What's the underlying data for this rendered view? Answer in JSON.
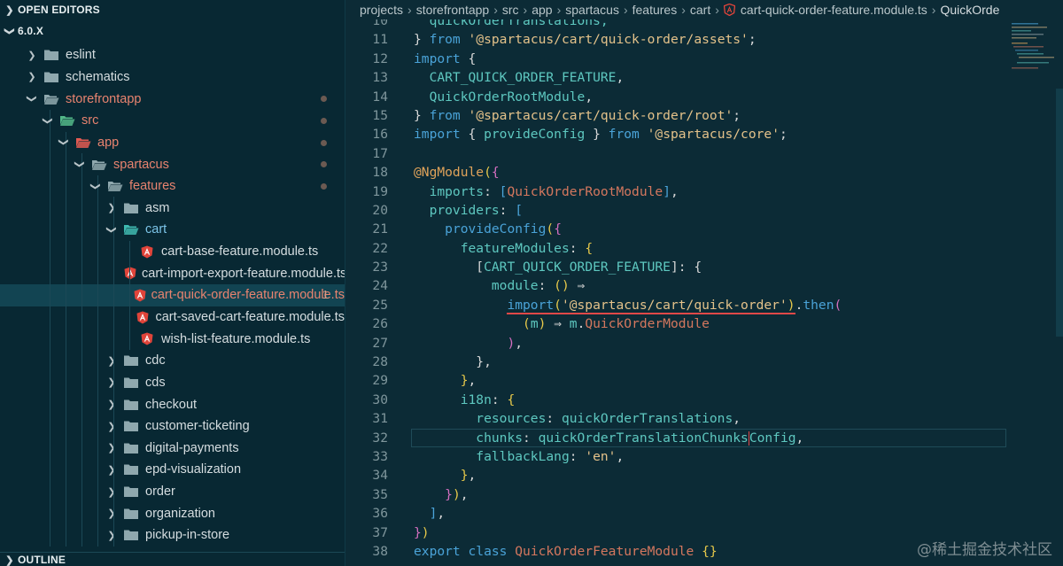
{
  "sidebar": {
    "open_editors_label": "OPEN EDITORS",
    "project_label": "6.0.X",
    "outline_label": "OUTLINE",
    "tree": [
      {
        "label": "eslint",
        "depth": 1,
        "type": "folder",
        "expanded": false,
        "git": false
      },
      {
        "label": "schematics",
        "depth": 1,
        "type": "folder",
        "expanded": false,
        "git": false
      },
      {
        "label": "storefrontapp",
        "depth": 1,
        "type": "folder-open",
        "expanded": true,
        "git": true,
        "dot": true
      },
      {
        "label": "src",
        "depth": 2,
        "type": "src-folder",
        "expanded": true,
        "git": true,
        "dot": true
      },
      {
        "label": "app",
        "depth": 3,
        "type": "app-folder",
        "expanded": true,
        "git": true,
        "dot": true
      },
      {
        "label": "spartacus",
        "depth": 4,
        "type": "folder-open",
        "expanded": true,
        "git": true,
        "dot": true
      },
      {
        "label": "features",
        "depth": 5,
        "type": "folder-open",
        "expanded": true,
        "git": true,
        "dot": true
      },
      {
        "label": "asm",
        "depth": 6,
        "type": "folder",
        "expanded": false,
        "git": false
      },
      {
        "label": "cart",
        "depth": 6,
        "type": "cart-folder",
        "expanded": true,
        "git": false,
        "blue": true
      },
      {
        "label": "cart-base-feature.module.ts",
        "depth": 7,
        "type": "angular",
        "git": false
      },
      {
        "label": "cart-import-export-feature.module.ts",
        "depth": 7,
        "type": "angular",
        "git": false
      },
      {
        "label": "cart-quick-order-feature.module.ts",
        "depth": 7,
        "type": "angular",
        "git": true,
        "active": true,
        "badge": "1"
      },
      {
        "label": "cart-saved-cart-feature.module.ts",
        "depth": 7,
        "type": "angular",
        "git": false
      },
      {
        "label": "wish-list-feature.module.ts",
        "depth": 7,
        "type": "angular",
        "git": false
      },
      {
        "label": "cdc",
        "depth": 6,
        "type": "folder",
        "expanded": false,
        "git": false
      },
      {
        "label": "cds",
        "depth": 6,
        "type": "folder",
        "expanded": false,
        "git": false
      },
      {
        "label": "checkout",
        "depth": 6,
        "type": "folder",
        "expanded": false,
        "git": false
      },
      {
        "label": "customer-ticketing",
        "depth": 6,
        "type": "folder",
        "expanded": false,
        "git": false
      },
      {
        "label": "digital-payments",
        "depth": 6,
        "type": "folder",
        "expanded": false,
        "git": false
      },
      {
        "label": "epd-visualization",
        "depth": 6,
        "type": "folder",
        "expanded": false,
        "git": false
      },
      {
        "label": "order",
        "depth": 6,
        "type": "folder",
        "expanded": false,
        "git": false
      },
      {
        "label": "organization",
        "depth": 6,
        "type": "folder",
        "expanded": false,
        "git": false
      },
      {
        "label": "pickup-in-store",
        "depth": 6,
        "type": "folder",
        "expanded": false,
        "git": false
      }
    ]
  },
  "breadcrumb": [
    "projects",
    "storefrontapp",
    "src",
    "app",
    "spartacus",
    "features",
    "cart",
    "cart-quick-order-feature.module.ts",
    "QuickOrde"
  ],
  "code": [
    {
      "n": "10",
      "t": [
        [
          "prop",
          "  quickOrderTranslations,"
        ]
      ]
    },
    {
      "n": "11",
      "t": [
        [
          "pu",
          "} "
        ],
        [
          "kw",
          "from"
        ],
        [
          "pu",
          " "
        ],
        [
          "str",
          "'@spartacus/cart/quick-order/assets'"
        ],
        [
          "pu",
          ";"
        ]
      ]
    },
    {
      "n": "12",
      "t": [
        [
          "kw",
          "import"
        ],
        [
          "pu",
          " {"
        ]
      ]
    },
    {
      "n": "13",
      "t": [
        [
          "pu",
          "  "
        ],
        [
          "prop",
          "CART_QUICK_ORDER_FEATURE"
        ],
        [
          "pu",
          ","
        ]
      ]
    },
    {
      "n": "14",
      "t": [
        [
          "pu",
          "  "
        ],
        [
          "prop",
          "QuickOrderRootModule"
        ],
        [
          "pu",
          ","
        ]
      ]
    },
    {
      "n": "15",
      "t": [
        [
          "pu",
          "} "
        ],
        [
          "kw",
          "from"
        ],
        [
          "pu",
          " "
        ],
        [
          "str",
          "'@spartacus/cart/quick-order/root'"
        ],
        [
          "pu",
          ";"
        ]
      ]
    },
    {
      "n": "16",
      "t": [
        [
          "kw",
          "import"
        ],
        [
          "pu",
          " { "
        ],
        [
          "prop",
          "provideConfig"
        ],
        [
          "pu",
          " } "
        ],
        [
          "kw",
          "from"
        ],
        [
          "pu",
          " "
        ],
        [
          "str",
          "'@spartacus/core'"
        ],
        [
          "pu",
          ";"
        ]
      ]
    },
    {
      "n": "17",
      "t": []
    },
    {
      "n": "18",
      "t": [
        [
          "dec",
          "@NgModule"
        ],
        [
          "br",
          "("
        ],
        [
          "br2",
          "{"
        ]
      ]
    },
    {
      "n": "19",
      "t": [
        [
          "pu",
          "  "
        ],
        [
          "prop",
          "imports"
        ],
        [
          "pu",
          ": "
        ],
        [
          "fn",
          "["
        ],
        [
          "id",
          "QuickOrderRootModule"
        ],
        [
          "fn",
          "]"
        ],
        [
          "pu",
          ","
        ]
      ]
    },
    {
      "n": "20",
      "t": [
        [
          "pu",
          "  "
        ],
        [
          "prop",
          "providers"
        ],
        [
          "pu",
          ": "
        ],
        [
          "fn",
          "["
        ]
      ]
    },
    {
      "n": "21",
      "t": [
        [
          "pu",
          "    "
        ],
        [
          "fn",
          "provideConfig"
        ],
        [
          "br",
          "("
        ],
        [
          "br2",
          "{"
        ]
      ]
    },
    {
      "n": "22",
      "t": [
        [
          "pu",
          "      "
        ],
        [
          "prop",
          "featureModules"
        ],
        [
          "pu",
          ": "
        ],
        [
          "br",
          "{"
        ]
      ]
    },
    {
      "n": "23",
      "t": [
        [
          "pu",
          "        "
        ],
        [
          "pu",
          "["
        ],
        [
          "prop",
          "CART_QUICK_ORDER_FEATURE"
        ],
        [
          "pu",
          "]: "
        ],
        [
          "pu",
          "{"
        ]
      ]
    },
    {
      "n": "24",
      "t": [
        [
          "pu",
          "          "
        ],
        [
          "prop",
          "module"
        ],
        [
          "pu",
          ": "
        ],
        [
          "br",
          "()"
        ],
        [
          "pu",
          " ⇒"
        ]
      ]
    },
    {
      "n": "25",
      "t": [
        [
          "pu",
          "            "
        ],
        [
          "kw",
          "import",
          "u"
        ],
        [
          "br",
          "(",
          "u"
        ],
        [
          "str",
          "'@spartacus/cart/quick-order'",
          "u"
        ],
        [
          "br",
          ")",
          "u"
        ],
        [
          "pu",
          "."
        ],
        [
          "fn",
          "then"
        ],
        [
          "br2",
          "("
        ]
      ]
    },
    {
      "n": "26",
      "t": [
        [
          "pu",
          "              "
        ],
        [
          "br",
          "("
        ],
        [
          "prop",
          "m"
        ],
        [
          "br",
          ")"
        ],
        [
          "pu",
          " ⇒ "
        ],
        [
          "prop",
          "m"
        ],
        [
          "pu",
          "."
        ],
        [
          "id",
          "QuickOrderModule"
        ]
      ]
    },
    {
      "n": "27",
      "t": [
        [
          "pu",
          "            "
        ],
        [
          "br2",
          ")"
        ],
        [
          "pu",
          ","
        ]
      ]
    },
    {
      "n": "28",
      "t": [
        [
          "pu",
          "        "
        ],
        [
          "pu",
          "},"
        ]
      ]
    },
    {
      "n": "29",
      "t": [
        [
          "pu",
          "      "
        ],
        [
          "br",
          "}"
        ],
        [
          "pu",
          ","
        ]
      ]
    },
    {
      "n": "30",
      "t": [
        [
          "pu",
          "      "
        ],
        [
          "prop",
          "i18n"
        ],
        [
          "pu",
          ": "
        ],
        [
          "br",
          "{"
        ]
      ]
    },
    {
      "n": "31",
      "t": [
        [
          "pu",
          "        "
        ],
        [
          "prop",
          "resources"
        ],
        [
          "pu",
          ": "
        ],
        [
          "prop",
          "quickOrderTranslations"
        ],
        [
          "pu",
          ","
        ]
      ]
    },
    {
      "n": "32",
      "t": [
        [
          "pu",
          "        "
        ],
        [
          "prop",
          "chunks"
        ],
        [
          "pu",
          ": "
        ],
        [
          "prop",
          "quickOrderTranslationChunks"
        ],
        [
          "cursor",
          ""
        ],
        [
          "prop",
          "Config"
        ],
        [
          "pu",
          ","
        ]
      ],
      "cur": true
    },
    {
      "n": "33",
      "t": [
        [
          "pu",
          "        "
        ],
        [
          "prop",
          "fallbackLang"
        ],
        [
          "pu",
          ": "
        ],
        [
          "str",
          "'en'"
        ],
        [
          "pu",
          ","
        ]
      ]
    },
    {
      "n": "34",
      "t": [
        [
          "pu",
          "      "
        ],
        [
          "br",
          "}"
        ],
        [
          "pu",
          ","
        ]
      ]
    },
    {
      "n": "35",
      "t": [
        [
          "pu",
          "    "
        ],
        [
          "br2",
          "}"
        ],
        [
          "br",
          ")"
        ],
        [
          "pu",
          ","
        ]
      ]
    },
    {
      "n": "36",
      "t": [
        [
          "pu",
          "  "
        ],
        [
          "fn",
          "]"
        ],
        [
          "pu",
          ","
        ]
      ]
    },
    {
      "n": "37",
      "t": [
        [
          "br2",
          "}"
        ],
        [
          "br",
          ")"
        ]
      ]
    },
    {
      "n": "38",
      "t": [
        [
          "kw",
          "export"
        ],
        [
          "pu",
          " "
        ],
        [
          "kw",
          "class"
        ],
        [
          "pu",
          " "
        ],
        [
          "cls",
          "QuickOrderFeatureModule"
        ],
        [
          "pu",
          " "
        ],
        [
          "br",
          "{}"
        ]
      ]
    }
  ],
  "watermark": "@稀土掘金技术社区",
  "colors": {
    "git_modified": "#e8836f",
    "accent_folder": "#7cc4e8",
    "angular": "#e0443a"
  }
}
